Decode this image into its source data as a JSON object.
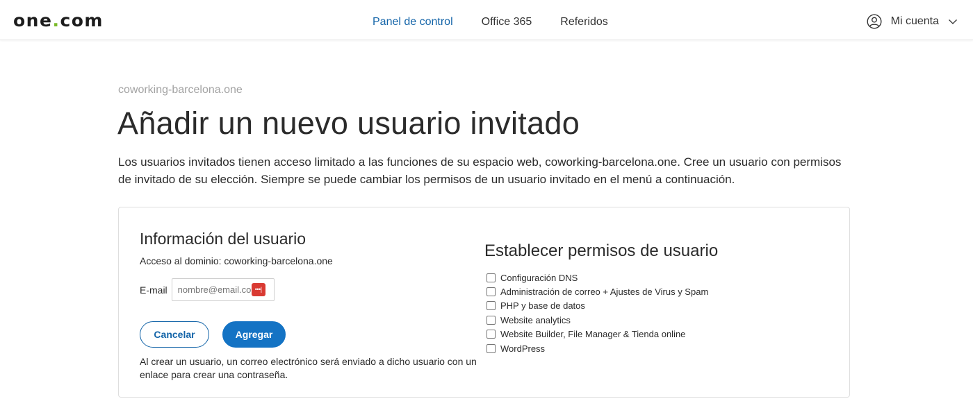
{
  "header": {
    "logo": {
      "part1": "one",
      "dot": ".",
      "part2": "com"
    },
    "nav": [
      {
        "label": "Panel de control",
        "active": true
      },
      {
        "label": "Office 365",
        "active": false
      },
      {
        "label": "Referidos",
        "active": false
      }
    ],
    "account_label": "Mi cuenta",
    "account_icon": "user-circle-icon",
    "chevron_icon": "chevron-down-icon"
  },
  "page": {
    "breadcrumb": "coworking-barcelona.one",
    "title": "Añadir un nuevo usuario invitado",
    "intro": "Los usuarios invitados tienen acceso limitado a las funciones de su espacio web, coworking-barcelona.one. Cree un usuario con permisos de invitado de su elección. Siempre se puede cambiar los permisos de un usuario invitado en el menú a continuación."
  },
  "user_info": {
    "title": "Información del usuario",
    "domain_access": "Acceso al dominio: coworking-barcelona.one",
    "email_label": "E-mail",
    "email_placeholder": "nombre@email.com",
    "email_value": "",
    "password_manager_icon": "password-manager-icon",
    "password_manager_glyph": "•••|",
    "cancel_label": "Cancelar",
    "add_label": "Agregar",
    "note": "Al crear un usuario, un correo electrónico será enviado a dicho usuario con un enlace para crear una contraseña."
  },
  "permissions": {
    "title": "Establecer permisos de usuario",
    "items": [
      {
        "label": "Configuración DNS",
        "checked": false
      },
      {
        "label": "Administración de correo + Ajustes de Virus y Spam",
        "checked": false
      },
      {
        "label": "PHP y base de datos",
        "checked": false
      },
      {
        "label": "Website analytics",
        "checked": false
      },
      {
        "label": "Website Builder, File Manager & Tienda online",
        "checked": false
      },
      {
        "label": "WordPress",
        "checked": false
      }
    ]
  },
  "colors": {
    "accent": "#1364a8",
    "primary_button": "#1473c4",
    "logo_dot": "#7ab929",
    "password_manager": "#d93a32"
  }
}
